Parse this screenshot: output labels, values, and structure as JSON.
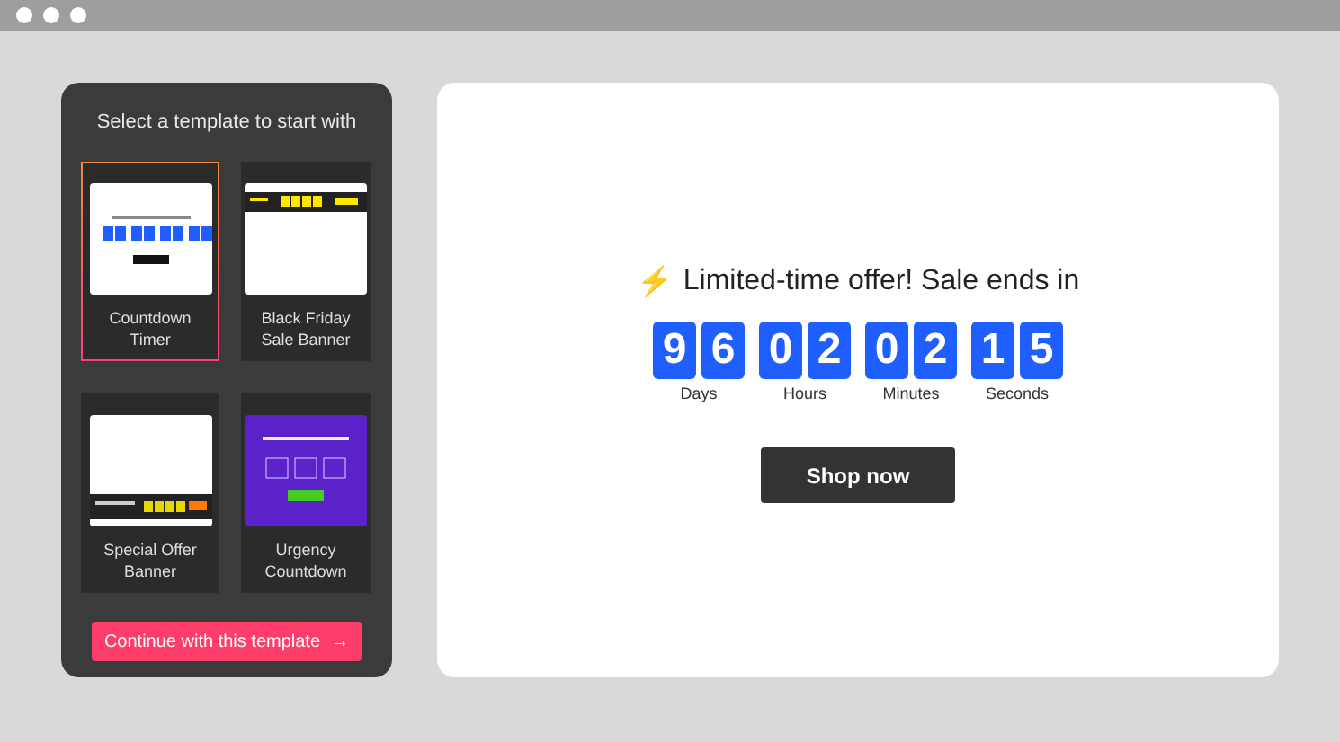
{
  "sidebar": {
    "title": "Select a template to start with",
    "templates": [
      {
        "kind": "countdown",
        "label": "Countdown Timer",
        "selected": true
      },
      {
        "kind": "blackfriday",
        "label": "Black Friday Sale Banner",
        "selected": false
      },
      {
        "kind": "special",
        "label": "Special Offer Banner",
        "selected": false
      },
      {
        "kind": "urgency",
        "label": "Urgency Countdown",
        "selected": false
      }
    ],
    "continue_button": "Continue with this template",
    "continue_icon": "→"
  },
  "preview": {
    "icon": "⚡",
    "headline": "Limited-time offer! Sale ends in",
    "units": [
      {
        "digits": [
          "9",
          "6"
        ],
        "label": "Days"
      },
      {
        "digits": [
          "0",
          "2"
        ],
        "label": "Hours"
      },
      {
        "digits": [
          "0",
          "2"
        ],
        "label": "Minutes"
      },
      {
        "digits": [
          "1",
          "5"
        ],
        "label": "Seconds"
      }
    ],
    "button": "Shop now"
  }
}
